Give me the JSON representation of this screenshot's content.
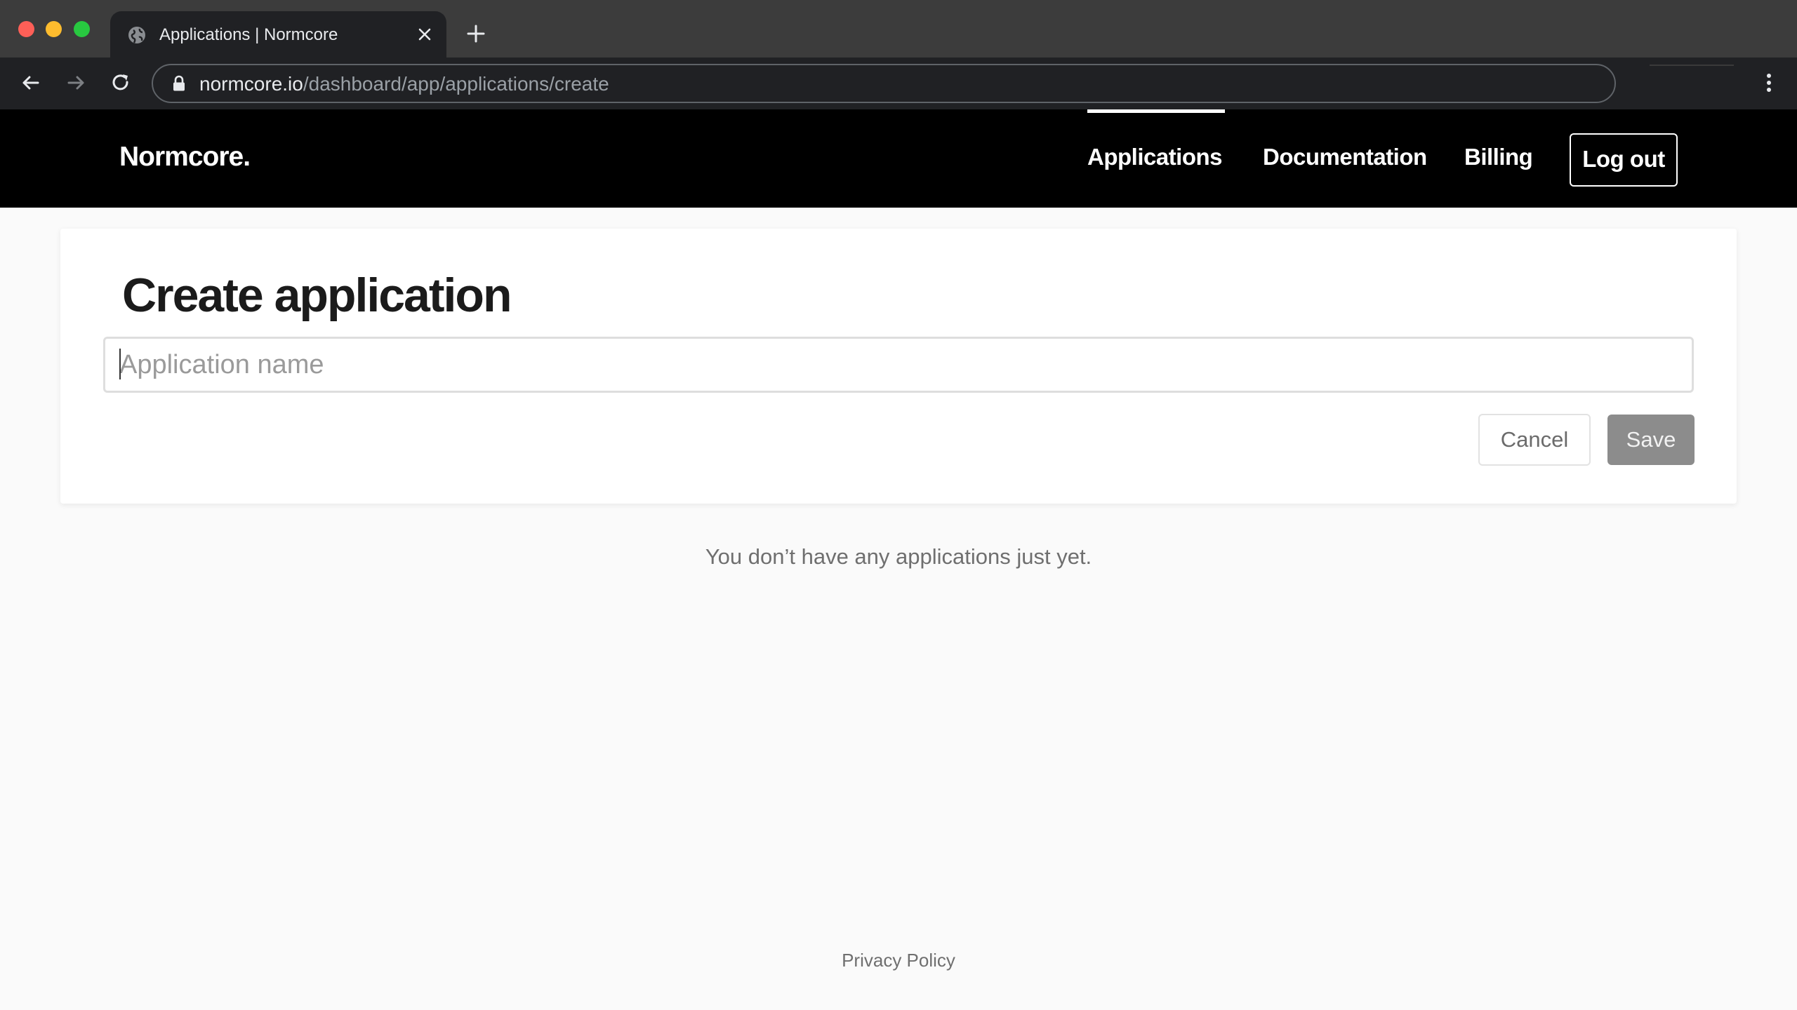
{
  "browser": {
    "tab": {
      "title": "Applications | Normcore",
      "favicon": "globe-icon",
      "close_icon": "close-icon"
    },
    "new_tab_icon": "plus-icon",
    "toolbar": {
      "back_icon": "arrow-left-icon",
      "forward_icon": "arrow-right-icon",
      "reload_icon": "reload-icon",
      "menu_icon": "kebab-menu-icon"
    },
    "address_bar": {
      "lock_icon": "lock-icon",
      "host": "normcore.io",
      "path": "/dashboard/app/applications/create"
    },
    "colors": {
      "chrome_frame": "#3c3c3c",
      "chrome_toolbar": "#202124",
      "traffic_red": "#fe5f57",
      "traffic_yellow": "#febc2e",
      "traffic_green": "#28c840"
    }
  },
  "site": {
    "logo": "Normcore.",
    "nav": {
      "items": [
        {
          "label": "Applications",
          "active": true
        },
        {
          "label": "Documentation",
          "active": false
        },
        {
          "label": "Billing",
          "active": false
        }
      ],
      "logout_label": "Log out"
    },
    "colors": {
      "header_bg": "#000000",
      "page_bg": "#fafafa",
      "save_button_bg": "#8c8c8c"
    }
  },
  "create_form": {
    "title": "Create application",
    "name_input": {
      "value": "",
      "placeholder": "Application name"
    },
    "cancel_label": "Cancel",
    "save_label": "Save"
  },
  "empty_state": "You don’t have any applications just yet.",
  "footer": {
    "privacy_label": "Privacy Policy"
  }
}
